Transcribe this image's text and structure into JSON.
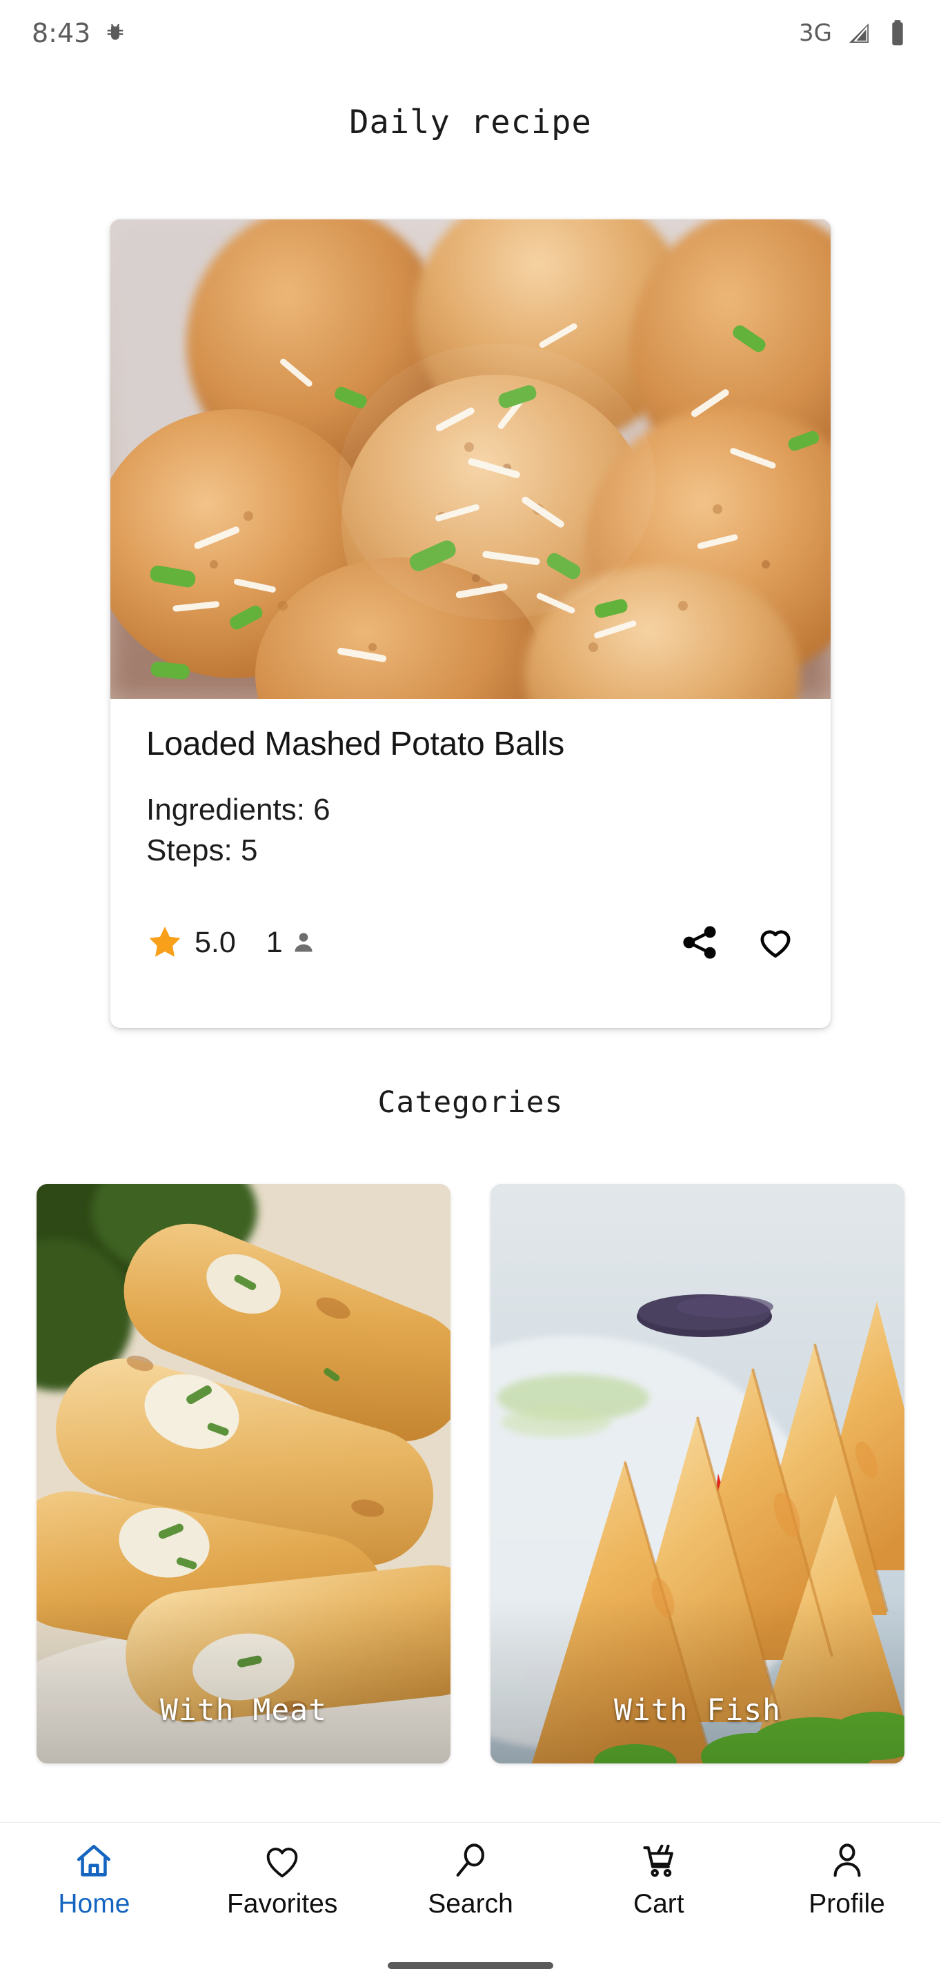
{
  "status_bar": {
    "time": "8:43",
    "left_icon": "android-bug-icon",
    "network": "3G",
    "signal_icon": "signal-bars-icon",
    "battery_icon": "battery-full-icon"
  },
  "header": {
    "title": "Daily recipe"
  },
  "daily_recipe": {
    "image_alt": "loaded-mashed-potato-balls-photo",
    "name": "Loaded Mashed Potato Balls",
    "ingredients_label": "Ingredients: 6",
    "steps_label": "Steps: 5",
    "rating_value": "5.0",
    "rating_count": "1",
    "star_icon": "star-filled-icon",
    "person_icon": "person-icon",
    "share_icon": "share-icon",
    "favorite_icon": "heart-outline-icon",
    "star_color": "#f9a01b"
  },
  "categories_section": {
    "title": "Categories",
    "items": [
      {
        "label": "With Meat",
        "image_alt": "taquitos-rolls-photo"
      },
      {
        "label": "With Fish",
        "image_alt": "samosa-plate-photo"
      }
    ]
  },
  "bottom_nav": {
    "active_color": "#1565c0",
    "items": [
      {
        "label": "Home",
        "icon": "home-icon",
        "active": true
      },
      {
        "label": "Favorites",
        "icon": "heart-outline-icon",
        "active": false
      },
      {
        "label": "Search",
        "icon": "search-icon",
        "active": false
      },
      {
        "label": "Cart",
        "icon": "cart-icon",
        "active": false
      },
      {
        "label": "Profile",
        "icon": "person-outline-icon",
        "active": false
      }
    ]
  },
  "system": {
    "gesture_bar": "home-gesture-bar"
  }
}
